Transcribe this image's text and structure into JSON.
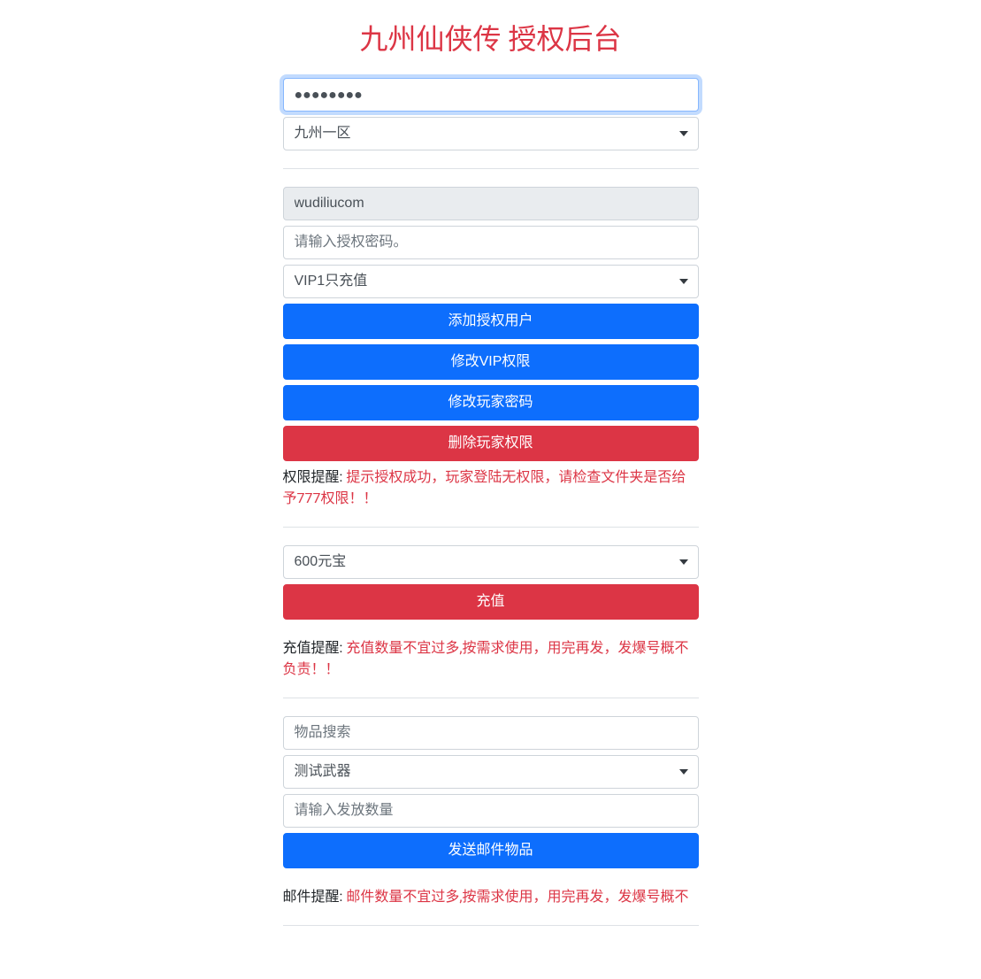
{
  "title": "九州仙侠传 授权后台",
  "top": {
    "password_value": "●●●●●●●●",
    "zone_select": "九州一区"
  },
  "auth": {
    "username_value": "wudiliucom",
    "password_placeholder": "请输入授权密码。",
    "vip_select": "VIP1只充值",
    "btn_add": "添加授权用户",
    "btn_modify_vip": "修改VIP权限",
    "btn_modify_pw": "修改玩家密码",
    "btn_delete": "删除玩家权限",
    "note_label": "权限提醒: ",
    "note_text": "提示授权成功，玩家登陆无权限，请检查文件夹是否给予777权限！！"
  },
  "recharge": {
    "amount_select": "600元宝",
    "btn_recharge": "充值",
    "note_label": "充值提醒: ",
    "note_text": "充值数量不宜过多,按需求使用，用完再发，发爆号概不负责！！"
  },
  "mail": {
    "search_placeholder": "物品搜索",
    "item_select": "测试武器",
    "qty_placeholder": "请输入发放数量",
    "btn_send": "发送邮件物品",
    "note_label": "邮件提醒: ",
    "note_text": "邮件数量不宜过多,按需求使用，用完再发，发爆号概不"
  }
}
